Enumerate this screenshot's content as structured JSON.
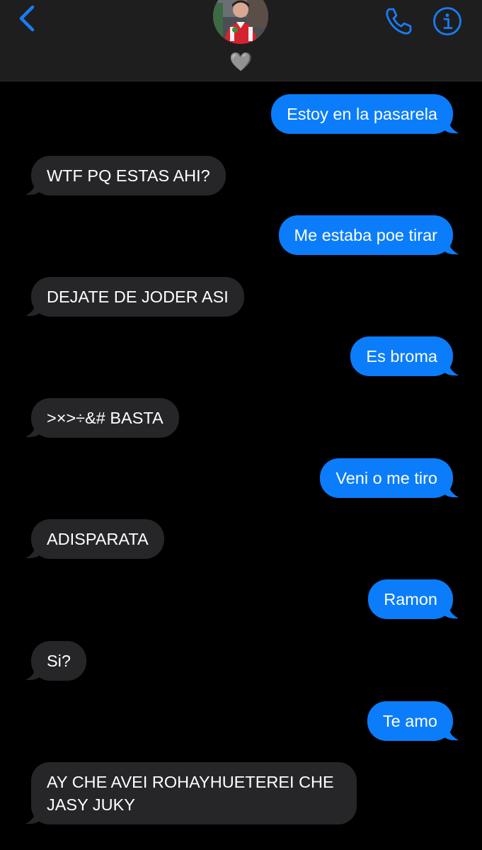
{
  "header": {
    "contact_name": "🩶",
    "back_icon": "chevron-left-icon",
    "call_icon": "phone-icon",
    "info_icon": "info-icon",
    "accent_color": "#1a7cf5",
    "background_color": "#1e1e1e"
  },
  "thread": {
    "sent_bubble_color": "#0b7dfb",
    "received_bubble_color": "#262629",
    "messages": [
      {
        "direction": "sent",
        "text": "Estoy en la pasarela"
      },
      {
        "direction": "received",
        "text": "WTF PQ ESTAS AHI?"
      },
      {
        "direction": "sent",
        "text": "Me estaba poe tirar"
      },
      {
        "direction": "received",
        "text": "DEJATE DE JODER ASI"
      },
      {
        "direction": "sent",
        "text": "Es broma"
      },
      {
        "direction": "received",
        "text": ">×>÷&# BASTA"
      },
      {
        "direction": "sent",
        "text": "Veni o me tiro"
      },
      {
        "direction": "received",
        "text": "ADISPARATA"
      },
      {
        "direction": "sent",
        "text": "Ramon"
      },
      {
        "direction": "received",
        "text": "Si?"
      },
      {
        "direction": "sent",
        "text": "Te amo"
      },
      {
        "direction": "received",
        "text": "AY CHE AVEI ROHAYHUETEREI CHE JASY JUKY"
      }
    ]
  }
}
